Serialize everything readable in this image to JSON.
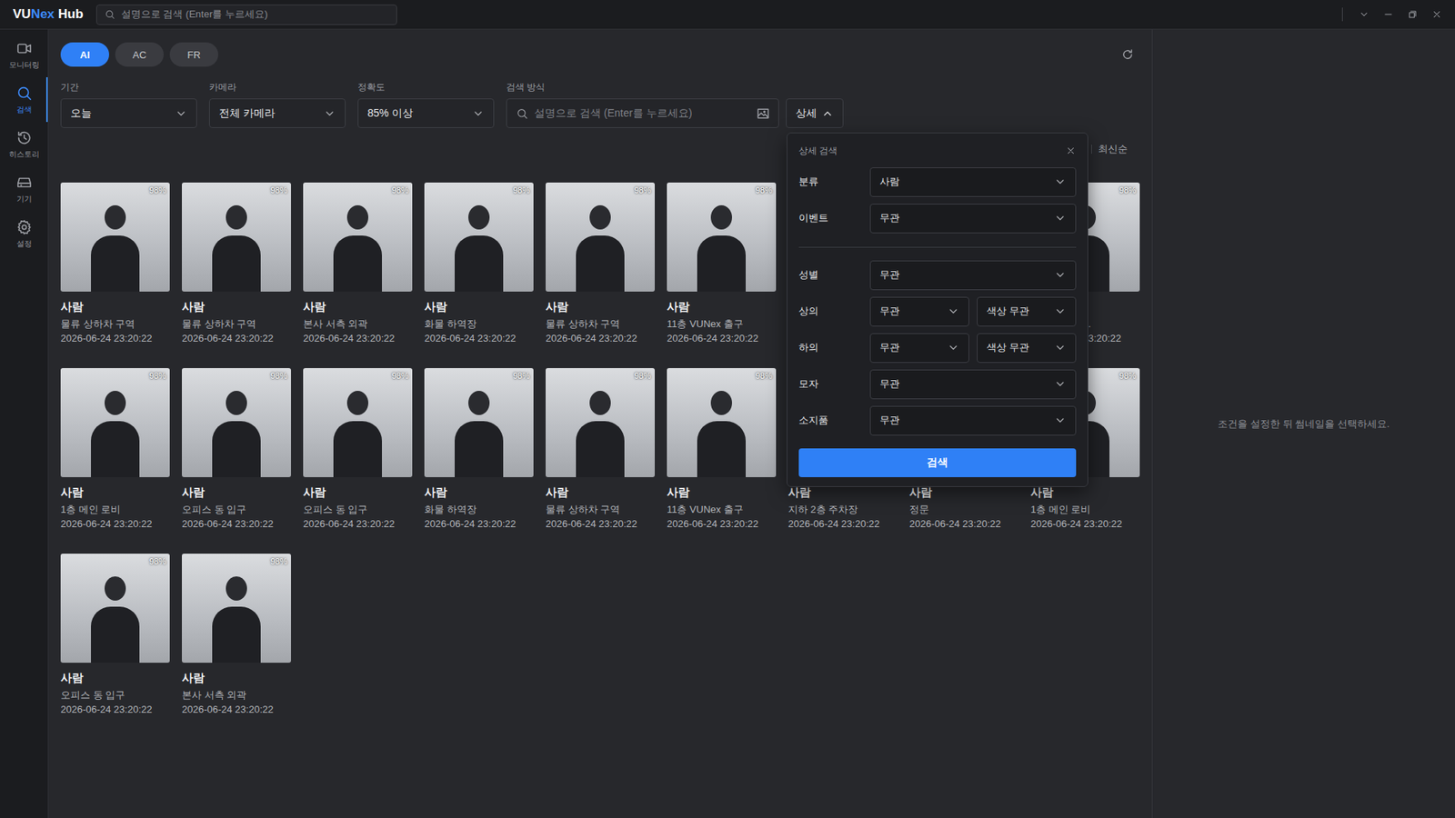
{
  "app": {
    "logo": [
      {
        "text": "VU",
        "color": "#ffffff"
      },
      {
        "text": "Nex",
        "color": "#3d8bfd"
      },
      {
        "text": "Hub",
        "color": "#ffffff"
      }
    ],
    "search_placeholder": "설명으로 검색 (Enter를 누르세요)"
  },
  "sidebar": [
    {
      "label": "모니터링",
      "selected": false
    },
    {
      "label": "검색",
      "selected": true
    },
    {
      "label": "히스토리",
      "selected": false
    },
    {
      "label": "기기",
      "selected": false
    },
    {
      "label": "설정",
      "selected": false
    }
  ],
  "tabs": [
    {
      "label": "AI",
      "selected": true
    },
    {
      "label": "AC",
      "selected": false
    },
    {
      "label": "FR",
      "selected": false
    }
  ],
  "filters": [
    {
      "label": "기간",
      "value": "오늘"
    },
    {
      "label": "카메라",
      "value": "전체 카메라"
    },
    {
      "label": "정확도",
      "value": "85% 이상"
    }
  ],
  "search_method": {
    "label": "검색 방식",
    "placeholder": "설명으로 검색 (Enter를 누르세요)"
  },
  "detail_button": {
    "label": "상세",
    "expanded": true
  },
  "sort": {
    "label": "최신순"
  },
  "cards": [
    {
      "kind": "photo",
      "title": "사람",
      "camera": "물류 상하차 구역",
      "time": "2026-06-24 23:20:22",
      "score": "98%"
    },
    {
      "kind": "photo",
      "title": "사람",
      "camera": "물류 상하차 구역",
      "time": "2026-06-24 23:20:22",
      "score": "98%"
    },
    {
      "kind": "photo",
      "title": "사람",
      "camera": "본사 서측 외곽",
      "time": "2026-06-24 23:20:22",
      "score": "98%"
    },
    {
      "kind": "photo",
      "title": "사람",
      "camera": "화물 하역장",
      "time": "2026-06-24 23:20:22",
      "score": "98%"
    },
    {
      "kind": "photo",
      "title": "사람",
      "camera": "물류 상하차 구역",
      "time": "2026-06-24 23:20:22",
      "score": "98%"
    },
    {
      "kind": "photo",
      "title": "사람",
      "camera": "11층 VUNex 출구",
      "time": "2026-06-24 23:20:22",
      "score": "98%"
    },
    {
      "kind": "covered"
    },
    {
      "kind": "covered"
    },
    {
      "kind": "clipped",
      "title": "",
      "camera": ".",
      "time": "3:20:22",
      "score": "98%"
    },
    {
      "kind": "photo",
      "title": "사람",
      "camera": "1층 메인 로비",
      "time": "2026-06-24 23:20:22",
      "score": "98%"
    },
    {
      "kind": "photo",
      "title": "사람",
      "camera": "오피스 동 입구",
      "time": "2026-06-24 23:20:22",
      "score": "98%"
    },
    {
      "kind": "photo",
      "title": "사람",
      "camera": "오피스 동 입구",
      "time": "2026-06-24 23:20:22",
      "score": "98%"
    },
    {
      "kind": "photo",
      "title": "사람",
      "camera": "화물 하역장",
      "time": "2026-06-24 23:20:22",
      "score": "98%"
    },
    {
      "kind": "photo",
      "title": "사람",
      "camera": "물류 상하차 구역",
      "time": "2026-06-24 23:20:22",
      "score": "98%"
    },
    {
      "kind": "photo",
      "title": "사람",
      "camera": "11층 VUNex 출구",
      "time": "2026-06-24 23:20:22",
      "score": "98%"
    },
    {
      "kind": "photo",
      "title": "사람",
      "camera": "지하 2층 주차장",
      "time": "2026-06-24 23:20:22",
      "score": ""
    },
    {
      "kind": "photo",
      "title": "사람",
      "camera": "정문",
      "time": "2026-06-24 23:20:22",
      "score": ""
    },
    {
      "kind": "photo",
      "title": "사람",
      "camera": "1층 메인 로비",
      "time": "2026-06-24 23:20:22",
      "score": "98%"
    },
    {
      "kind": "photo",
      "title": "사람",
      "camera": "오피스 동 입구",
      "time": "2026-06-24 23:20:22",
      "score": "98%"
    },
    {
      "kind": "photo",
      "title": "사람",
      "camera": "본사 서측 외곽",
      "time": "2026-06-24 23:20:22",
      "score": "98%"
    }
  ],
  "detail": {
    "title": "상세 검색",
    "groups": [
      [
        {
          "label": "분류",
          "fields": [
            "사람"
          ]
        },
        {
          "label": "이벤트",
          "fields": [
            "무관"
          ]
        }
      ],
      [
        {
          "label": "성별",
          "fields": [
            "무관"
          ]
        },
        {
          "label": "상의",
          "fields": [
            "무관",
            "색상 무관"
          ]
        },
        {
          "label": "하의",
          "fields": [
            "무관",
            "색상 무관"
          ]
        },
        {
          "label": "모자",
          "fields": [
            "무관"
          ]
        },
        {
          "label": "소지품",
          "fields": [
            "무관"
          ]
        }
      ]
    ],
    "search_button": "검색"
  },
  "preview": {
    "hint": "조건을 설정한 뒤 썸네일을 선택하세요."
  }
}
